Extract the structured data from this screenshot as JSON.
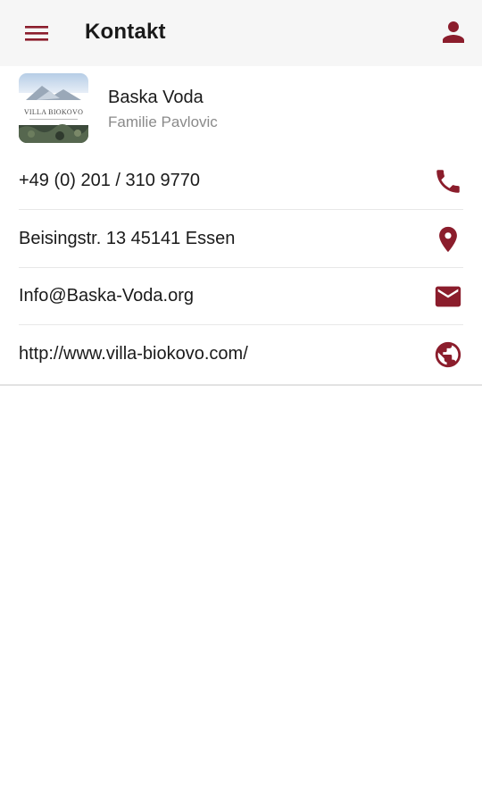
{
  "app_bar": {
    "title": "Kontakt",
    "menu_icon": "hamburger-menu-icon",
    "user_icon": "person-icon"
  },
  "contact": {
    "logo_text": "VILLA BIOKOVO",
    "name": "Baska Voda",
    "subtitle": "Familie Pavlovic"
  },
  "details": [
    {
      "text": "+49 (0) 201 / 310 9770",
      "icon": "phone-icon"
    },
    {
      "text": "Beisingstr. 13 45141 Essen",
      "icon": "location-pin-icon"
    },
    {
      "text": "Info@Baska-Voda.org",
      "icon": "email-icon"
    },
    {
      "text": "http://www.villa-biokovo.com/",
      "icon": "globe-icon"
    }
  ],
  "colors": {
    "accent": "#8b1d2c",
    "app_bar_bg": "#f6f6f6",
    "text": "#1a1a1a",
    "subtext": "#8a8a8a"
  }
}
